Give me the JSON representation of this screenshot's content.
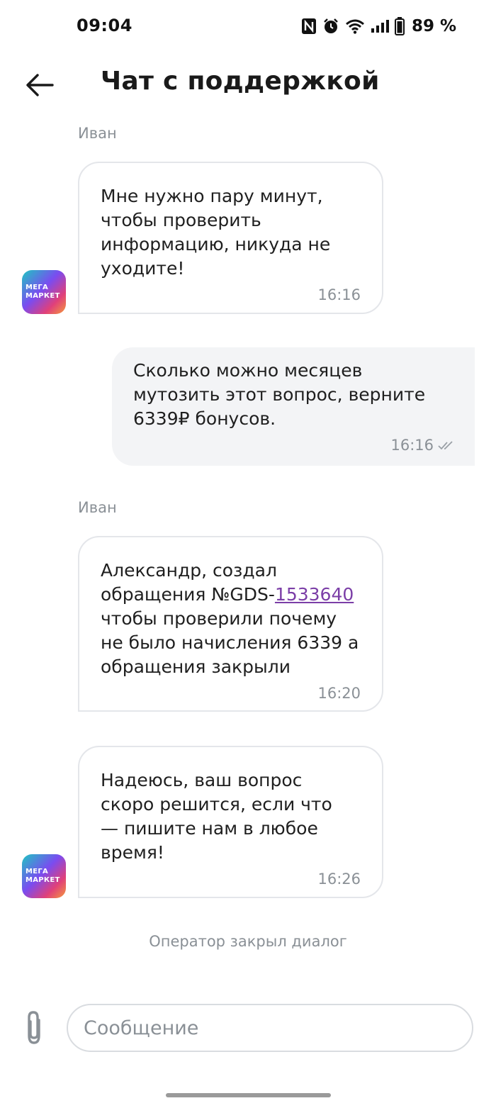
{
  "status_bar": {
    "time": "09:04",
    "battery": "89 %"
  },
  "header": {
    "title": "Чат с поддержкой"
  },
  "brand": {
    "avatar_line1": "МЕГА",
    "avatar_line2": "МАРКЕТ"
  },
  "messages": [
    {
      "direction": "incoming",
      "sender": "Иван",
      "text": "Мне нужно пару минут,\nчтобы проверить\nинформацию, никуда не\nуходите!",
      "time": "16:16"
    },
    {
      "direction": "outgoing",
      "text": "Сколько можно месяцев\nмутозить этот вопрос, верните\n6339₽ бонусов.",
      "time": "16:16",
      "status": "read"
    },
    {
      "direction": "incoming",
      "sender": "Иван",
      "text_before_link": "Александр, создал\nобращения №GDS-",
      "link_text": "1533640",
      "text_after_link": "\nчтобы проверили почему\nне было начисления 6339 а\nобращения закрыли",
      "time": "16:20"
    },
    {
      "direction": "incoming",
      "text": "Надеюсь, ваш вопрос\nскоро решится, если что\n— пишите нам в любое\nвремя!",
      "time": "16:26"
    }
  ],
  "system_note": "Оператор закрыл диалог",
  "composer": {
    "placeholder": "Сообщение"
  },
  "colors": {
    "link": "#7b3ea7",
    "muted_text": "#8a9096",
    "outgoing_bubble": "#f3f4f6",
    "incoming_border": "#e4e6ea"
  }
}
